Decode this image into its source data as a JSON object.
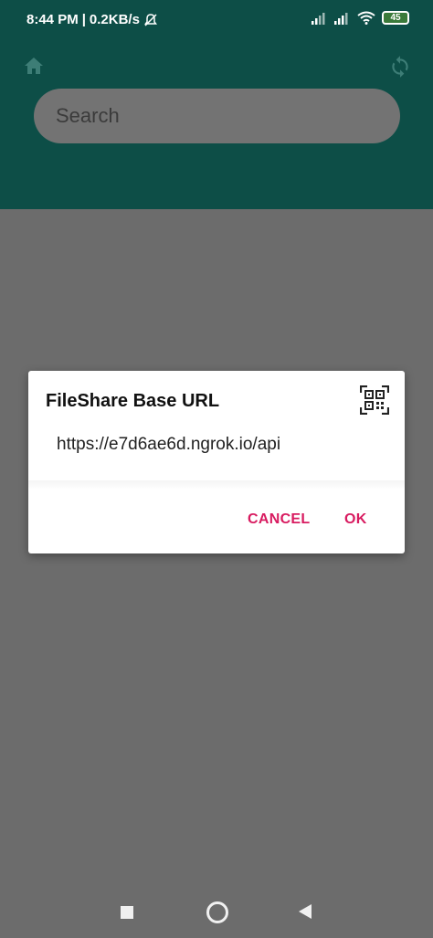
{
  "status_bar": {
    "time": "8:44 PM",
    "separator": "|",
    "speed": "0.2KB/s",
    "battery": "45"
  },
  "toolbar": {
    "search_placeholder": "Search"
  },
  "dialog": {
    "title": "FileShare Base URL",
    "url_value": "https://e7d6ae6d.ngrok.io/api",
    "cancel_label": "CANCEL",
    "ok_label": "OK"
  },
  "colors": {
    "app_bar": "#0d4e47",
    "accent": "#d81b60",
    "scrim": "#6c6c6c"
  }
}
